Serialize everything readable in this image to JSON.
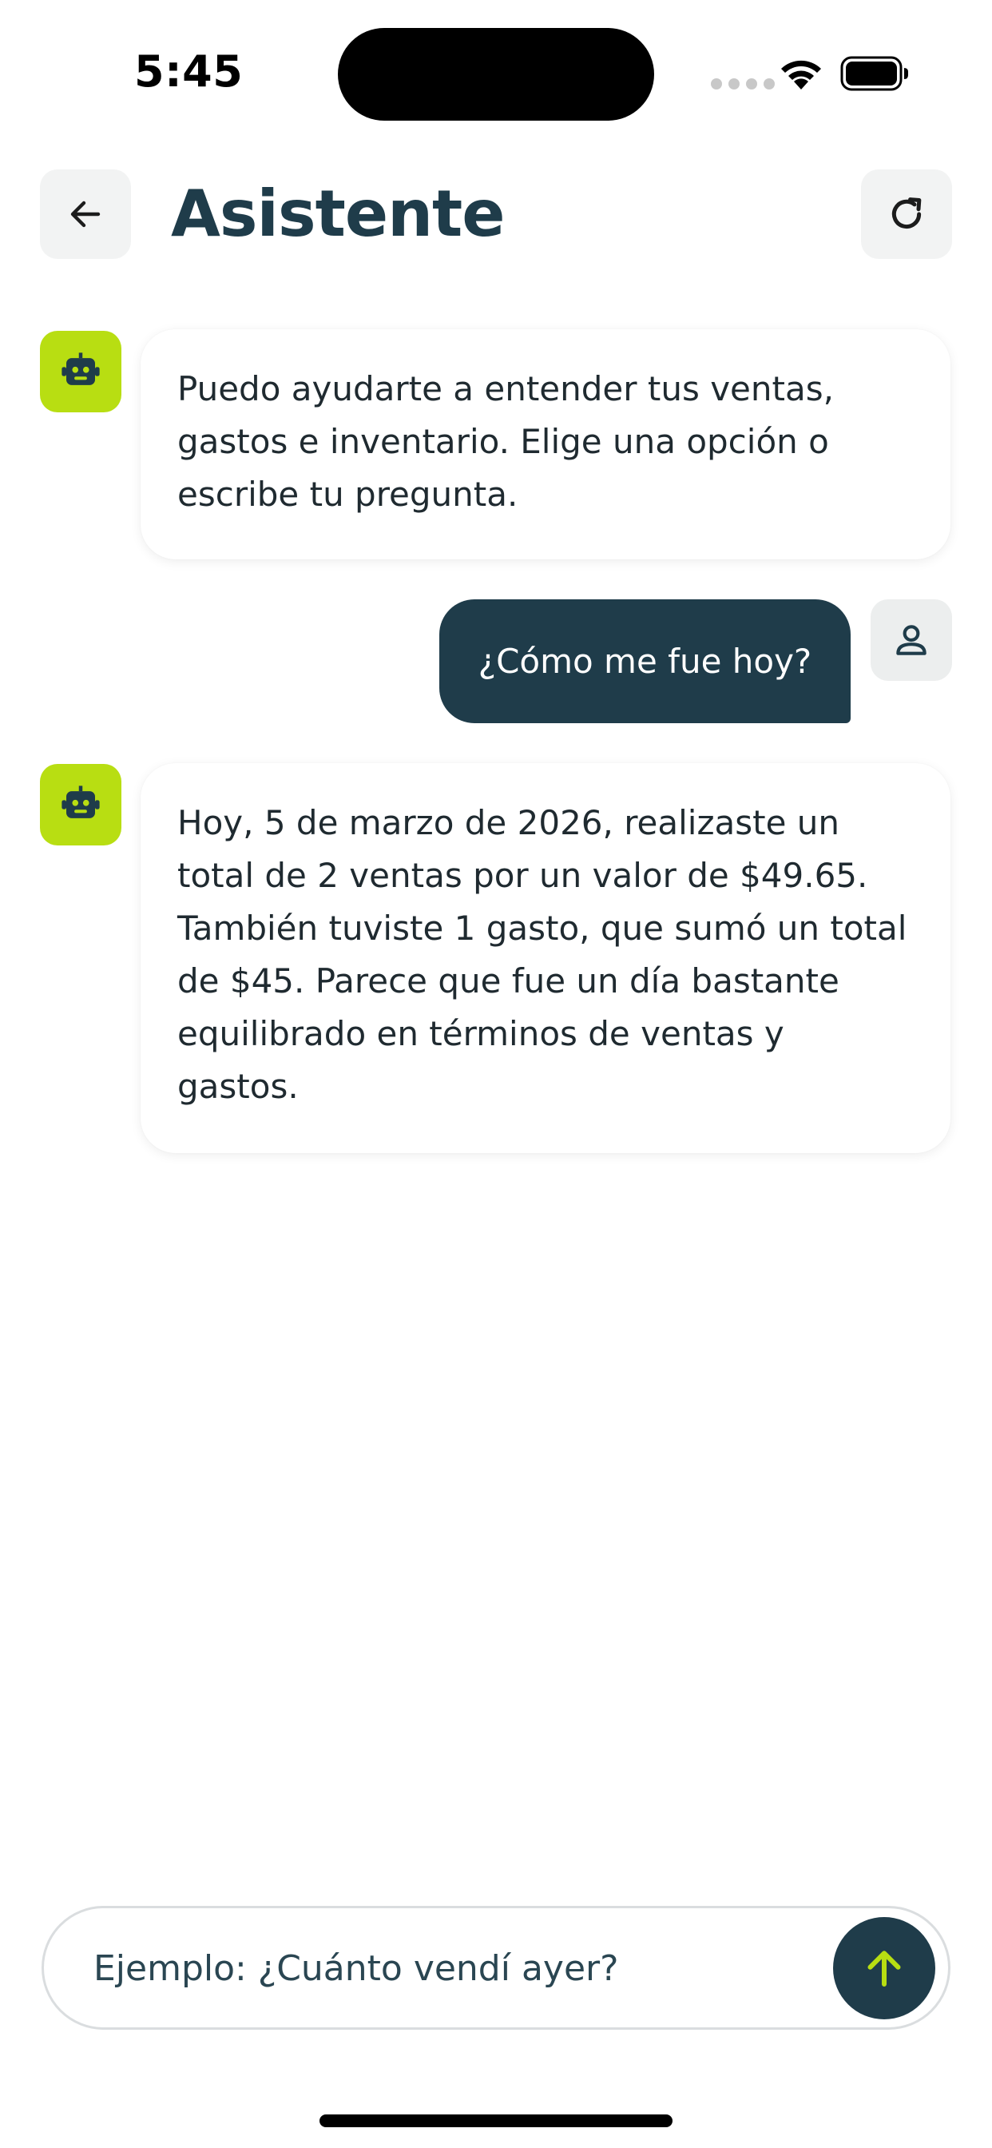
{
  "status_bar": {
    "time": "5:45"
  },
  "header": {
    "title": "Asistente",
    "back_icon": "arrow-left-icon",
    "refresh_icon": "refresh-icon"
  },
  "messages": [
    {
      "role": "assistant",
      "avatar_icon": "robot-icon",
      "text": "Puedo ayudarte a entender tus ventas, gastos e inventario. Elige una opción o escribe tu pregunta."
    },
    {
      "role": "user",
      "avatar_icon": "user-icon",
      "text": "¿Cómo me fue hoy?"
    },
    {
      "role": "assistant",
      "avatar_icon": "robot-icon",
      "text": "Hoy, 5 de marzo de 2026, realizaste un total de 2 ventas por un valor de $49.65. También tuviste 1 gasto, que sumó un total de $45. Parece que fue un día bastante equilibrado en términos de ventas y gastos."
    }
  ],
  "input": {
    "placeholder": "Ejemplo: ¿Cuánto vendí ayer?",
    "value": "",
    "send_icon": "arrow-up-icon"
  },
  "colors": {
    "primary": "#1f3c4a",
    "accent": "#b8de12",
    "surface": "#f2f3f3"
  }
}
